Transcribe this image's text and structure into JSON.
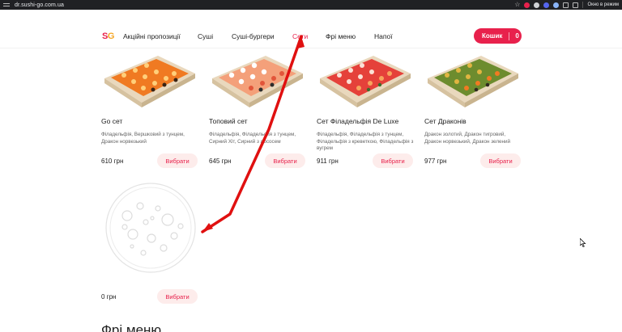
{
  "browser": {
    "url": "dr.sushi-go.com.ua",
    "window_label": "Окно в режим",
    "icons": [
      "tune-icon",
      "star-icon",
      "extension-icon",
      "profile-icon",
      "puzzle-icon",
      "sidebar-icon"
    ]
  },
  "header": {
    "logo": {
      "s": "S",
      "g": "G"
    },
    "nav": [
      {
        "label": "Акційні пропозиції",
        "active": false
      },
      {
        "label": "Суші",
        "active": false
      },
      {
        "label": "Суші-бургери",
        "active": false
      },
      {
        "label": "Сети",
        "active": true
      },
      {
        "label": "Фрі меню",
        "active": false
      },
      {
        "label": "Напої",
        "active": false
      }
    ],
    "cart": {
      "label": "Кошик",
      "count": "0"
    }
  },
  "products": [
    {
      "title": "Go сет",
      "desc": "Філадельфія, Вершковий з тунцем, Дракон норвезький",
      "price": "610 грн",
      "button": "Вибрати",
      "image": "sushi-set-image"
    },
    {
      "title": "Топовий сет",
      "desc": "Філадельфія, Філадельфія з тунцем, Сирний Хіт, Сирний з лососем",
      "price": "645 грн",
      "button": "Вибрати",
      "image": "sushi-set-image"
    },
    {
      "title": "Сет Філадельфія De Luxe",
      "desc": "Філадельфія, Філадельфія з тунцем, Філадельфія з креветкою, Філадельфія з вугрем",
      "price": "911 грн",
      "button": "Вибрати",
      "image": "sushi-set-image"
    },
    {
      "title": "Сет Драконів",
      "desc": "Дракон золотий, Дракон тигровий, Дракон норвезький, Дракон зелений",
      "price": "977 грн",
      "button": "Вибрати",
      "image": "sushi-set-image"
    },
    {
      "title": "",
      "desc": "",
      "price": "0 грн",
      "button": "Вибрати",
      "image": "pizza-placeholder-icon"
    }
  ],
  "section_title": "Фрі меню",
  "colors": {
    "accent": "#e8214c",
    "button_bg": "#fdeceb",
    "annotation_arrow": "#e01010",
    "logo_g": "#f5a623"
  }
}
